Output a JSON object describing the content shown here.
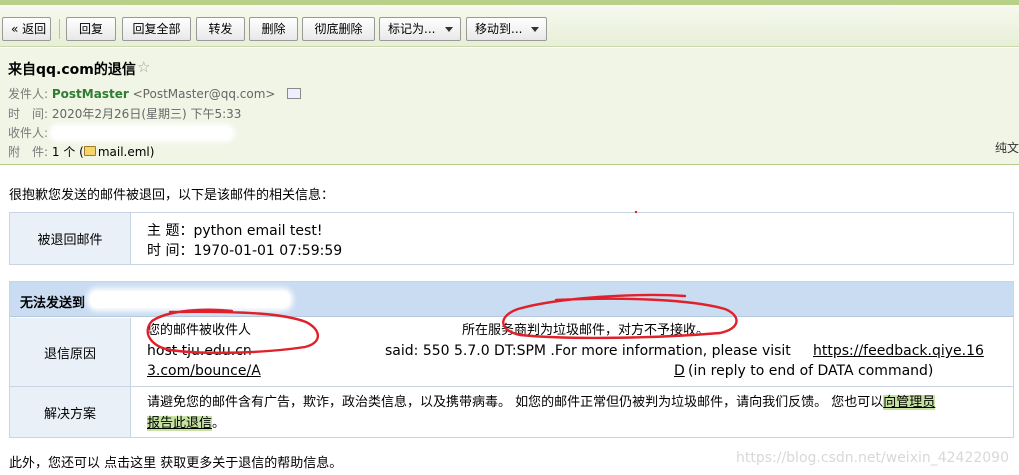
{
  "toolbar": {
    "back": "« 返回",
    "reply": "回复",
    "reply_all": "回复全部",
    "forward": "转发",
    "delete": "删除",
    "delete_permanently": "彻底删除",
    "mark_as": "标记为...",
    "move_to": "移动到..."
  },
  "mail": {
    "subject": "来自qq.com的退信",
    "sender_label": "发件人:",
    "sender_name": "PostMaster",
    "sender_address": "<PostMaster@qq.com>",
    "time_label": "时　间:",
    "time_value": "2020年2月26日(星期三) 下午5:33",
    "recipient_label": "收件人:",
    "attachment_label": "附　件:",
    "attachment_count": "1 个 (",
    "attachment_name": "mail.eml",
    "attachment_close": ")",
    "plain_text": "纯文"
  },
  "body": {
    "intro": "很抱歉您发送的邮件被退回，以下是该邮件的相关信息：",
    "returned_mail_label": "被退回邮件",
    "subject_line": "主 题：python email test!",
    "time_line": "时 间：1970-01-01 07:59:59",
    "undeliverable_label": "无法发送到",
    "reason_label": "退信原因",
    "reason_line1_a": "您的邮件被收件人",
    "reason_line1_b": "所在服务商判为垃圾邮件，对方不予接收。",
    "reason_line2_a": "host tju.edu.cn",
    "reason_line2_b": "said: 550 5.7.0 DT:SPM .For more information, please visit ",
    "reason_link_part1": "https://feedback.qiye.16",
    "reason_link_part2": "3.com/bounce/A",
    "reason_link_tail": "D",
    "reason_line3_end": "(in reply to end of DATA command)",
    "solution_label": "解决方案",
    "solution_text": "请避免您的邮件含有广告，欺诈，政治类信息，以及携带病毒。 如您的邮件正常但仍被判为垃圾邮件，请向我们反馈。 您也可以",
    "solution_link_1": "向管理员",
    "solution_link_2": "报告此退信",
    "solution_end": "。"
  },
  "footer": {
    "prefix": "此外，您还可以 ",
    "link": "点击这里",
    "suffix": " 获取更多关于退信的帮助信息。"
  },
  "watermark": "https://blog.csdn.net/weixin_42422090",
  "colors": {
    "toolbar_bg": "#e7efd7",
    "header_bg": "#f0f5e6",
    "sender_green": "#2e7d32",
    "table_label_bg": "#e9f0f8",
    "table_title_bg": "#c9dcf1",
    "ink_annotation": "#e0202a",
    "link_highlight": "#c7e3a3"
  },
  "icons": {
    "star": "star-icon",
    "vcard": "contact-card-icon",
    "attachment": "attachment-icon",
    "dropdown": "chevron-down-icon"
  }
}
